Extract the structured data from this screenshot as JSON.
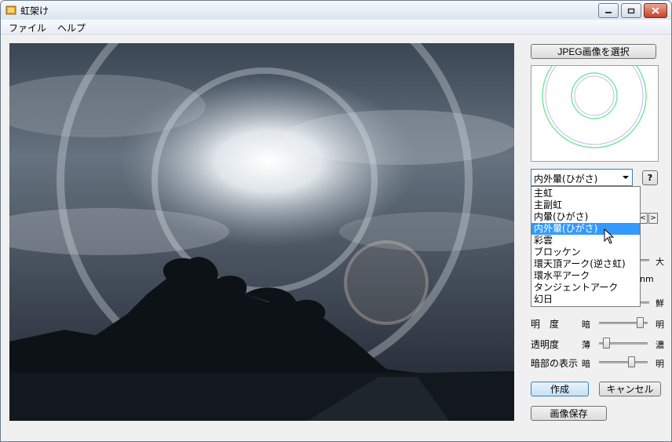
{
  "window": {
    "title": "虹架け",
    "controls": {
      "minimize": "minimize-icon",
      "maximize": "maximize-icon",
      "close": "close-icon"
    }
  },
  "menu": [
    {
      "label": "ファイル"
    },
    {
      "label": "ヘルプ"
    }
  ],
  "panel": {
    "select_jpeg_label": "JPEG画像を選択",
    "effect_combo": {
      "selected": "内外暈(ひがさ)",
      "options": [
        "主虹",
        "主副虹",
        "内暈(ひがさ)",
        "内外暈(ひがさ)",
        "彩雲",
        "ブロッケン",
        "環天頂アーク(逆さ虹)",
        "環水平アーク",
        "タンジェントアーク",
        "幻日"
      ],
      "selected_index": 3
    },
    "help_label": "?",
    "partial": {
      "large": "大",
      "nm": "nm",
      "vivid": "鮮"
    },
    "sliders": [
      {
        "label": "明　度",
        "left": "暗",
        "right": "明",
        "value": 0.85
      },
      {
        "label": "透明度",
        "left": "薄",
        "right": "濃",
        "value": 0.15
      },
      {
        "label": "暗部の表示",
        "left": "暗",
        "right": "明",
        "value": 0.65
      }
    ],
    "create_label": "作成",
    "cancel_label": "キャンセル",
    "save_label": "画像保存"
  },
  "colors": {
    "accent": "#3399ff",
    "ring": "#7be8a0"
  }
}
